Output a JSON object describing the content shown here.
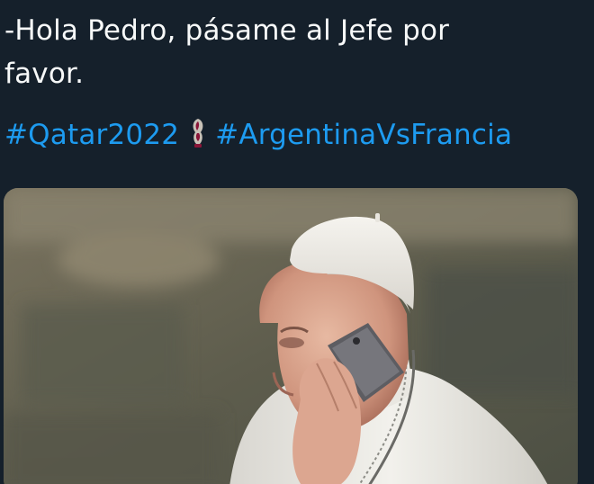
{
  "tweet": {
    "line1": "-Hola Pedro, pásame al Jefe por",
    "line2": "favor.",
    "hashtags": [
      "#Qatar2022",
      "#ArgentinaVsFrancia"
    ],
    "emoji": "fifa-world-cup-trophy-emoji"
  },
  "media": {
    "type": "photo",
    "subject": "person-on-phone"
  },
  "colors": {
    "background": "#15202b",
    "text": "#f7f9f9",
    "hashtag": "#1d9bf0"
  }
}
